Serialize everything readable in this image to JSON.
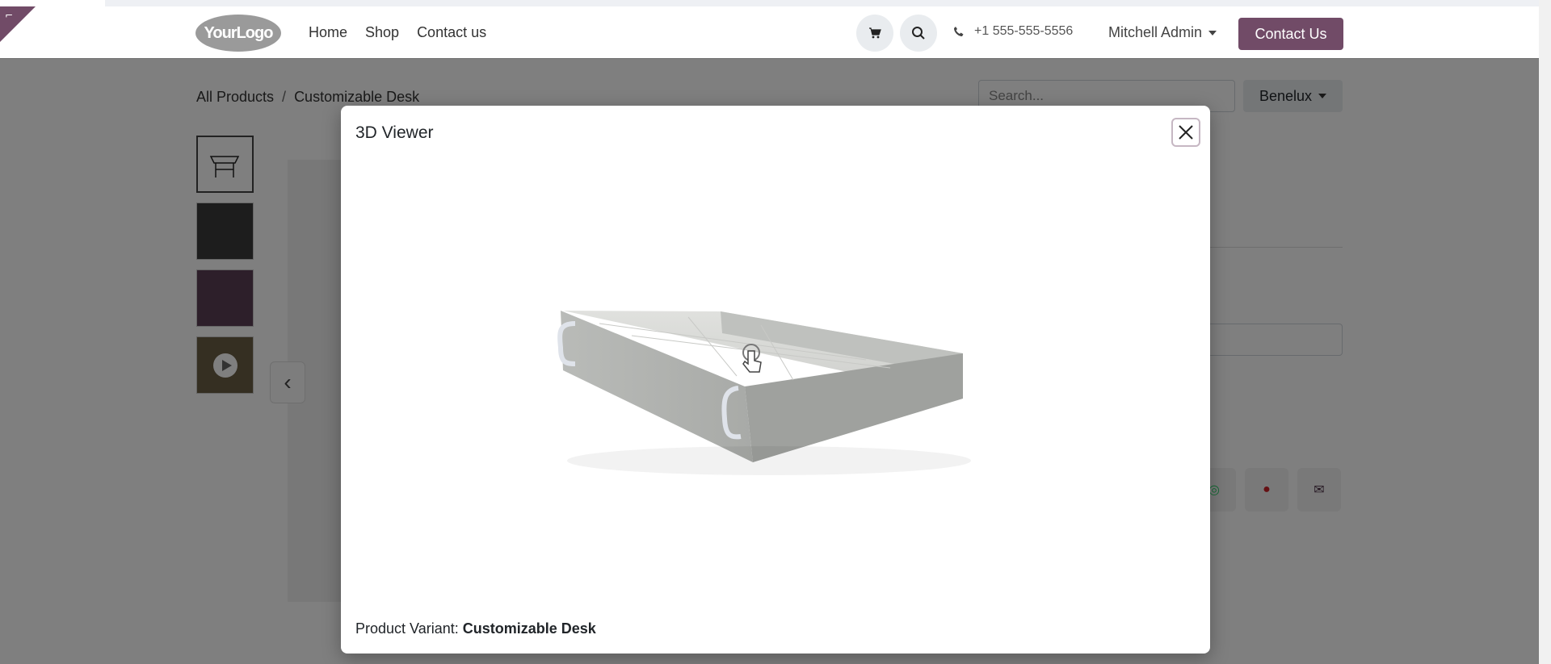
{
  "header": {
    "logo_text": "YourLogo",
    "nav": [
      "Home",
      "Shop",
      "Contact us"
    ],
    "phone": "+1 555-555-5556",
    "user": "Mitchell Admin",
    "cta": "Contact Us"
  },
  "breadcrumb": [
    "All Products",
    "Customizable Desk"
  ],
  "search": {
    "placeholder": "Search..."
  },
  "pricelist": "Benelux",
  "modal": {
    "title": "3D Viewer",
    "footer_label": "Product Variant:",
    "footer_value": "Customizable Desk"
  },
  "colors": {
    "brand": "#714b67",
    "whatsapp": "#25d366",
    "pinterest": "#cb2027",
    "email": "#4a2f44"
  }
}
